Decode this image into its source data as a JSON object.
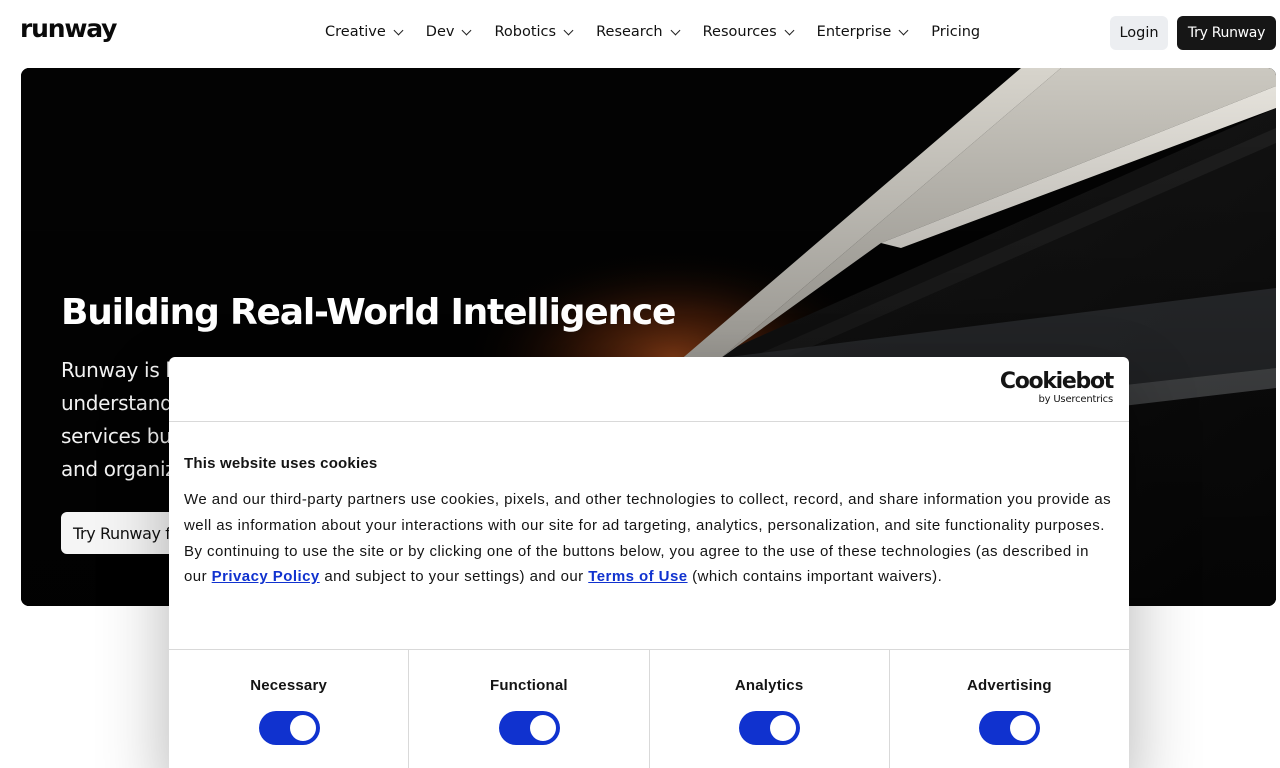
{
  "brand": {
    "logo": "runway"
  },
  "nav": {
    "items": [
      {
        "label": "Creative",
        "has_dropdown": true
      },
      {
        "label": "Dev",
        "has_dropdown": true
      },
      {
        "label": "Robotics",
        "has_dropdown": true
      },
      {
        "label": "Research",
        "has_dropdown": true
      },
      {
        "label": "Resources",
        "has_dropdown": true
      },
      {
        "label": "Enterprise",
        "has_dropdown": true
      },
      {
        "label": "Pricing",
        "has_dropdown": false
      }
    ],
    "login_label": "Login",
    "try_label": "Try Runway"
  },
  "hero": {
    "title": "Building Real-World Intelligence",
    "lines": [
      "Runway is b",
      "understand",
      "services bu",
      "and organiz"
    ],
    "cta_label": "Try Runway f"
  },
  "cookie": {
    "logo_main": "Cookiebot",
    "logo_sub": "by Usercentrics",
    "title": "This website uses cookies",
    "paragraph1": "We and our third-party partners use cookies, pixels, and other technologies to collect, record, and share information you provide as well as information about your interactions with our site for ad targeting, analytics, personalization, and site functionality purposes.",
    "p2_a": "By continuing to use the site or by clicking one of the buttons below, you agree to the use of these technologies (as described in our ",
    "privacy_link": "Privacy Policy",
    "p2_b": " and subject to your settings) and our ",
    "terms_link": "Terms of Use",
    "p2_c": " (which contains important waivers).",
    "categories": [
      {
        "label": "Necessary",
        "enabled": true
      },
      {
        "label": "Functional",
        "enabled": true
      },
      {
        "label": "Analytics",
        "enabled": true
      },
      {
        "label": "Advertising",
        "enabled": true
      }
    ]
  },
  "colors": {
    "toggle_on": "#1032cf",
    "link": "#1032cf",
    "try_button": "#161616"
  }
}
